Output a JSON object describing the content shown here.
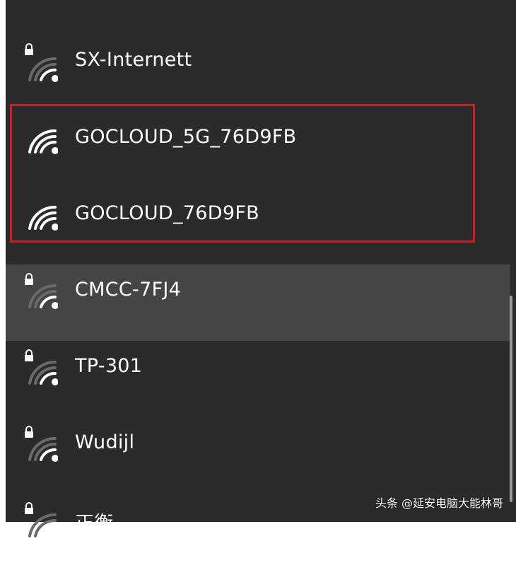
{
  "networks": [
    {
      "ssid": "SX-Internett",
      "secured": true,
      "selected": false
    },
    {
      "ssid": "GOCLOUD_5G_76D9FB",
      "secured": false,
      "selected": false
    },
    {
      "ssid": "GOCLOUD_76D9FB",
      "secured": false,
      "selected": false
    },
    {
      "ssid": "CMCC-7FJ4",
      "secured": true,
      "selected": true
    },
    {
      "ssid": "TP-301",
      "secured": true,
      "selected": false
    },
    {
      "ssid": "Wudijl",
      "secured": true,
      "selected": false
    },
    {
      "ssid": "正衡",
      "secured": true,
      "selected": false
    }
  ],
  "watermark": "头条 @延安电脑大能林哥",
  "colors": {
    "panel_bg": "#2b2b2b",
    "selected_bg": "#454545",
    "highlight_border": "#c8202a",
    "text": "#ffffff"
  },
  "icons": {
    "wifi": "wifi-signal-icon",
    "lock": "lock-icon"
  }
}
